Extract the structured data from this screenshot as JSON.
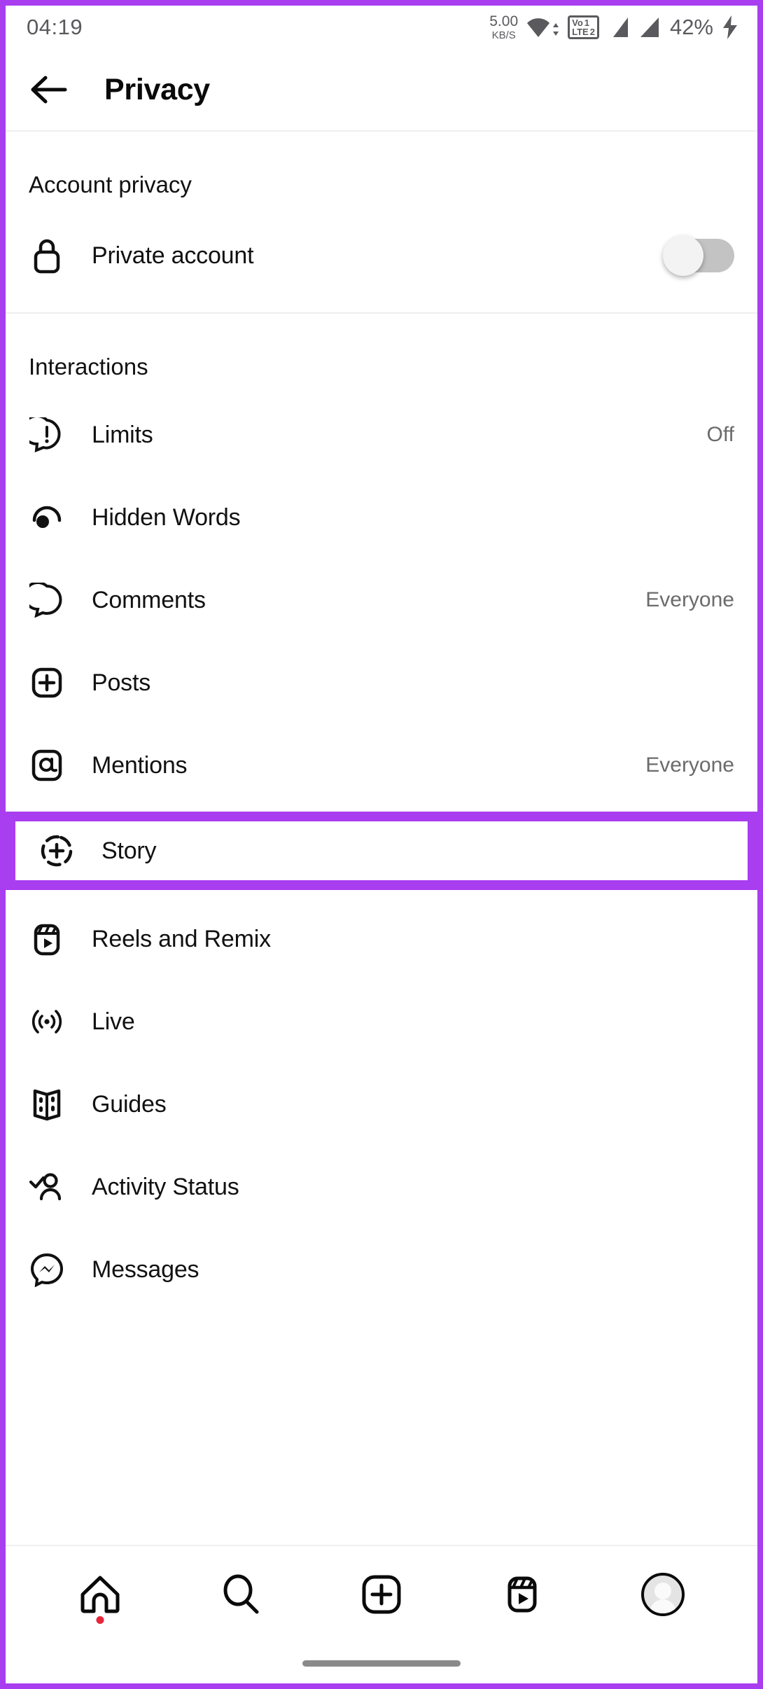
{
  "status_bar": {
    "time": "04:19",
    "net_speed_value": "5.00",
    "net_speed_unit": "KB/S",
    "wifi_icon": "wifi-icon",
    "volte_label_top": "Vo",
    "volte_label_bottom": "LTE",
    "sim1": "1",
    "sim2": "2",
    "signal_icon_1": "signal-bars-icon",
    "signal_icon_2": "signal-bars-icon",
    "battery_percent": "42%",
    "charging_icon": "charging-bolt-icon"
  },
  "header": {
    "back_icon": "back-arrow-icon",
    "title": "Privacy"
  },
  "sections": [
    {
      "heading": "Account privacy",
      "rows": [
        {
          "icon": "lock-icon",
          "label": "Private account",
          "control": "toggle",
          "toggle_on": false
        }
      ]
    },
    {
      "heading": "Interactions",
      "rows": [
        {
          "icon": "limits-icon",
          "label": "Limits",
          "value": "Off"
        },
        {
          "icon": "hidden-words-icon",
          "label": "Hidden Words",
          "value": ""
        },
        {
          "icon": "comment-icon",
          "label": "Comments",
          "value": "Everyone"
        },
        {
          "icon": "post-icon",
          "label": "Posts",
          "value": ""
        },
        {
          "icon": "mention-icon",
          "label": "Mentions",
          "value": "Everyone"
        },
        {
          "icon": "story-icon",
          "label": "Story",
          "value": "",
          "highlighted": true
        },
        {
          "icon": "reels-icon",
          "label": "Reels and Remix",
          "value": ""
        },
        {
          "icon": "live-icon",
          "label": "Live",
          "value": ""
        },
        {
          "icon": "guides-icon",
          "label": "Guides",
          "value": ""
        },
        {
          "icon": "activity-status-icon",
          "label": "Activity Status",
          "value": ""
        },
        {
          "icon": "messenger-icon",
          "label": "Messages",
          "value": ""
        }
      ]
    }
  ],
  "bottom_nav": [
    {
      "icon": "home-icon",
      "badge": true
    },
    {
      "icon": "search-icon",
      "badge": false
    },
    {
      "icon": "create-icon",
      "badge": false
    },
    {
      "icon": "reels-nav-icon",
      "badge": false
    },
    {
      "icon": "profile-avatar-icon",
      "badge": false
    }
  ],
  "colors": {
    "highlight": "#a93df0",
    "text_primary": "#111111",
    "text_secondary": "#6b6b6b",
    "badge": "#e8253b"
  }
}
